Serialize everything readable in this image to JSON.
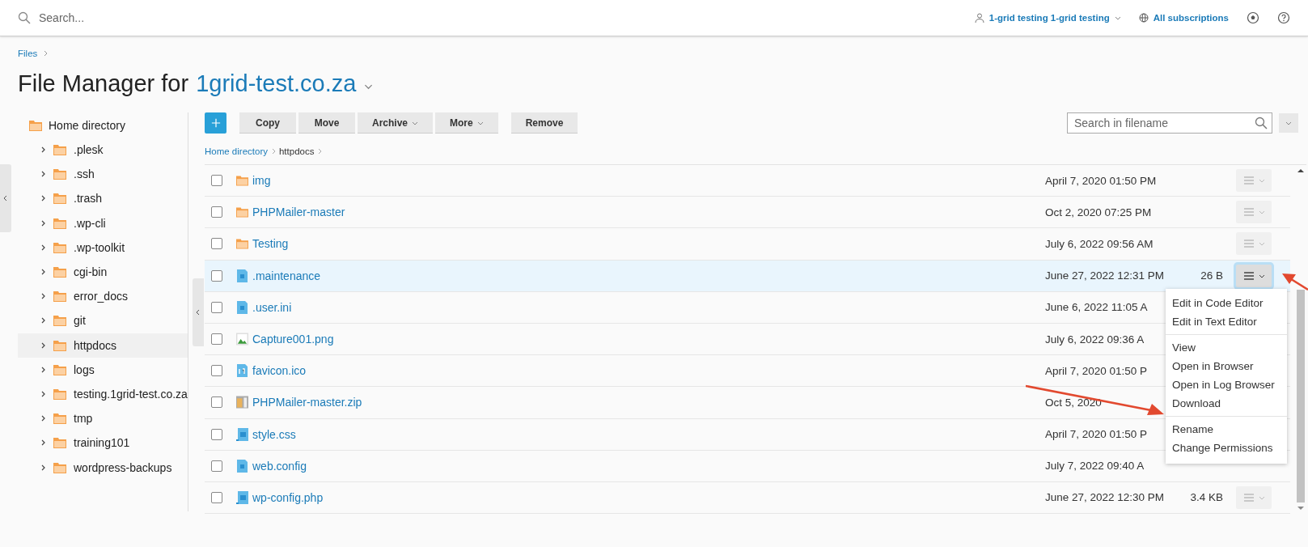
{
  "top_bar": {
    "search": {
      "placeholder": "Search..."
    },
    "user": "1-grid testing 1-grid testing",
    "subscriptions": "All subscriptions"
  },
  "breadcrumb": [
    "Files"
  ],
  "title": {
    "prefix": "File Manager for",
    "domain": "1grid-test.co.za"
  },
  "sidebar": {
    "root": "Home directory",
    "items": [
      {
        "label": ".plesk",
        "expanded": false,
        "selected": false
      },
      {
        "label": ".ssh",
        "expanded": false,
        "selected": false
      },
      {
        "label": ".trash",
        "expanded": false,
        "selected": false
      },
      {
        "label": ".wp-cli",
        "expanded": false,
        "selected": false
      },
      {
        "label": ".wp-toolkit",
        "expanded": false,
        "selected": false
      },
      {
        "label": "cgi-bin",
        "expanded": false,
        "selected": false
      },
      {
        "label": "error_docs",
        "expanded": false,
        "selected": false
      },
      {
        "label": "git",
        "expanded": false,
        "selected": false
      },
      {
        "label": "httpdocs",
        "expanded": false,
        "selected": true
      },
      {
        "label": "logs",
        "expanded": false,
        "selected": false
      },
      {
        "label": "testing.1grid-test.co.za",
        "expanded": false,
        "selected": false
      },
      {
        "label": "tmp",
        "expanded": false,
        "selected": false
      },
      {
        "label": "training101",
        "expanded": false,
        "selected": false
      },
      {
        "label": "wordpress-backups",
        "expanded": false,
        "selected": false
      }
    ]
  },
  "toolbar": {
    "buttons": [
      {
        "label": "Copy",
        "dropdown": false
      },
      {
        "label": "Move",
        "dropdown": false
      },
      {
        "label": "Archive",
        "dropdown": true
      },
      {
        "label": "More",
        "dropdown": true
      },
      {
        "label": "Remove",
        "dropdown": false
      }
    ],
    "search": {
      "placeholder": "Search in filename"
    }
  },
  "path": [
    {
      "label": "Home directory",
      "link": true
    },
    {
      "label": "httpdocs",
      "link": false
    }
  ],
  "files": [
    {
      "name": "img",
      "kind": "folder",
      "checked": false,
      "highlighted": false,
      "modified": "April 7, 2020 01:50 PM",
      "menu_open": false
    },
    {
      "name": "PHPMailer-master",
      "kind": "folder",
      "checked": false,
      "highlighted": false,
      "modified": "Oct 2, 2020 07:25 PM",
      "menu_open": false
    },
    {
      "name": "Testing",
      "kind": "folder",
      "checked": false,
      "highlighted": false,
      "modified": "July 6, 2022 09:56 AM",
      "menu_open": false
    },
    {
      "name": ".maintenance",
      "kind": "text",
      "checked": false,
      "highlighted": true,
      "modified": "June 27, 2022 12:31 PM",
      "size": "26 B",
      "menu_open": true
    },
    {
      "name": ".user.ini",
      "kind": "text",
      "checked": false,
      "highlighted": false,
      "modified": "June 6, 2022 11:05 A"
    },
    {
      "name": "Capture001.png",
      "kind": "image",
      "checked": false,
      "highlighted": false,
      "modified": "July 6, 2022 09:36 A"
    },
    {
      "name": "favicon.ico",
      "kind": "binary",
      "checked": false,
      "highlighted": false,
      "modified": "April 7, 2020 01:50 P"
    },
    {
      "name": "PHPMailer-master.zip",
      "kind": "archive",
      "checked": false,
      "highlighted": false,
      "modified": "Oct 5, 2020"
    },
    {
      "name": "style.css",
      "kind": "code",
      "checked": false,
      "highlighted": false,
      "modified": "April 7, 2020 01:50 P"
    },
    {
      "name": "web.config",
      "kind": "text",
      "checked": false,
      "highlighted": false,
      "modified": "July 7, 2022 09:40 A"
    },
    {
      "name": "wp-config.php",
      "kind": "code",
      "checked": false,
      "highlighted": false,
      "modified": "June 27, 2022 12:30 PM",
      "size": "3.4 KB",
      "menu_open": false
    }
  ],
  "context_menu": {
    "groups": [
      [
        "Edit in Code Editor",
        "Edit in Text Editor"
      ],
      [
        "View",
        "Open in Browser",
        "Open in Log Browser",
        "Download"
      ],
      [
        "Rename",
        "Change Permissions"
      ]
    ]
  }
}
